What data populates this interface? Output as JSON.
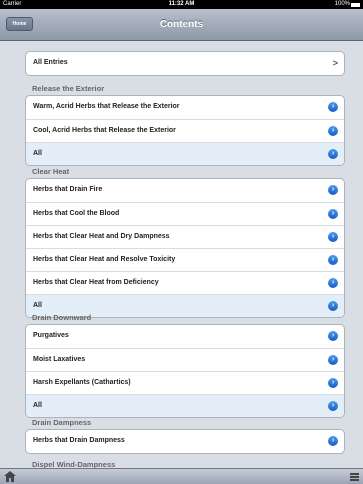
{
  "status": {
    "carrier": "Carrier",
    "time": "11:32 AM",
    "battery": "100%"
  },
  "nav": {
    "title": "Contents",
    "home_label": "Home"
  },
  "all_entries": {
    "label": "All Entries",
    "chevron": ">"
  },
  "sections": [
    {
      "header": "Release the Exterior",
      "items": [
        "Warm, Acrid Herbs that Release the Exterior",
        "Cool, Acrid Herbs that Release the Exterior",
        "All"
      ]
    },
    {
      "header": "Clear Heat",
      "items": [
        "Herbs that Drain Fire",
        "Herbs that Cool the Blood",
        "Herbs that Clear Heat and Dry Dampness",
        "Herbs that Clear Heat and Resolve Toxicity",
        "Herbs that Clear Heat from Deficiency",
        "All"
      ]
    },
    {
      "header": "Drain Downward",
      "items": [
        "Purgatives",
        "Moist Laxatives",
        "Harsh Expellants (Cathartics)",
        "All"
      ]
    },
    {
      "header": "Drain Dampness",
      "items": [
        "Herbs that Drain Dampness"
      ]
    },
    {
      "header": "Dispel Wind-Dampness",
      "items": []
    }
  ],
  "icons": {
    "disclosure": "detail-disclosure-icon",
    "home": "home-icon",
    "menu": "menu-icon"
  },
  "colors": {
    "disclosure_blue": "#1a5cc4",
    "all_row_bg": "#e4eef9",
    "background": "#d9dde4"
  }
}
